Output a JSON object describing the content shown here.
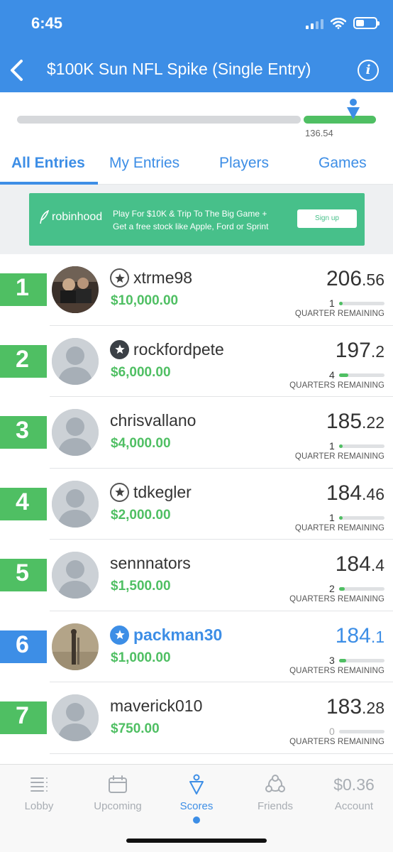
{
  "status": {
    "time": "6:45"
  },
  "header": {
    "title": "$100K Sun NFL Spike (Single Entry)",
    "back_icon": "chevron-left-icon",
    "info_icon": "info-icon"
  },
  "progress": {
    "value_label": "136.54",
    "marker_icon": "person-pin-icon",
    "colors": {
      "track": "#d6d8db",
      "fill": "#4fbf63"
    }
  },
  "tabs": [
    {
      "label": "All Entries",
      "active": true
    },
    {
      "label": "My Entries"
    },
    {
      "label": "Players"
    },
    {
      "label": "Games"
    }
  ],
  "ad": {
    "logo": "robinhood",
    "line1": "Play For $10K & Trip To The Big Game +",
    "line2": "Get a free stock like Apple, Ford or Sprint",
    "button": "Sign up"
  },
  "entries": [
    {
      "rank": "1",
      "username": "xtrme98",
      "badge": "outline",
      "prize": "$10,000.00",
      "score_int": "206",
      "score_dec": ".56",
      "remaining": "1",
      "remaining_fraction": 0.08,
      "remaining_label": "QUARTER REMAINING",
      "avatar": "photo-dark"
    },
    {
      "rank": "2",
      "username": "rockfordpete",
      "badge": "filled",
      "prize": "$6,000.00",
      "score_int": "197",
      "score_dec": ".2",
      "remaining": "4",
      "remaining_fraction": 0.2,
      "remaining_label": "QUARTERS REMAINING",
      "avatar": "default"
    },
    {
      "rank": "3",
      "username": "chrisvallano",
      "badge": "none",
      "prize": "$4,000.00",
      "score_int": "185",
      "score_dec": ".22",
      "remaining": "1",
      "remaining_fraction": 0.08,
      "remaining_label": "QUARTER REMAINING",
      "avatar": "default"
    },
    {
      "rank": "4",
      "username": "tdkegler",
      "badge": "outline",
      "prize": "$2,000.00",
      "score_int": "184",
      "score_dec": ".46",
      "remaining": "1",
      "remaining_fraction": 0.08,
      "remaining_label": "QUARTER REMAINING",
      "avatar": "default"
    },
    {
      "rank": "5",
      "username": "sennnators",
      "badge": "none",
      "prize": "$1,500.00",
      "score_int": "184",
      "score_dec": ".4",
      "remaining": "2",
      "remaining_fraction": 0.12,
      "remaining_label": "QUARTERS REMAINING",
      "avatar": "default"
    },
    {
      "rank": "6",
      "username": "packman30",
      "badge": "blue",
      "prize": "$1,000.00",
      "score_int": "184",
      "score_dec": ".1",
      "remaining": "3",
      "remaining_fraction": 0.16,
      "remaining_label": "QUARTERS REMAINING",
      "avatar": "photo-light",
      "is_me": true
    },
    {
      "rank": "7",
      "username": "maverick010",
      "badge": "none",
      "prize": "$750.00",
      "score_int": "183",
      "score_dec": ".28",
      "remaining": "0",
      "remaining_fraction": 0,
      "remaining_label": "QUARTERS REMAINING",
      "avatar": "default"
    }
  ],
  "nav": {
    "lobby": "Lobby",
    "upcoming": "Upcoming",
    "scores": "Scores",
    "friends": "Friends",
    "account_value": "$0.36",
    "account": "Account"
  },
  "colors": {
    "brand_blue": "#3d8ee6",
    "green": "#4fbf63"
  }
}
